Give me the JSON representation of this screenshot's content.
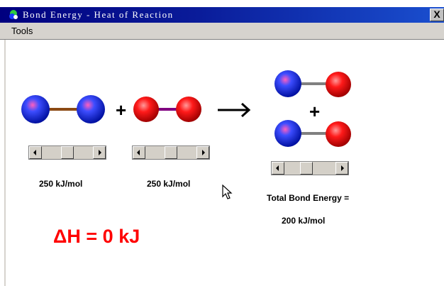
{
  "window": {
    "title": "Bond Energy - Heat of Reaction",
    "close_label": "X"
  },
  "menu": {
    "tools": "Tools"
  },
  "reactants": {
    "plus": "+",
    "bond1_energy": "250 kJ/mol",
    "bond2_energy": "250 kJ/mol",
    "slider1_fraction": 0.5,
    "slider2_fraction": 0.5
  },
  "products": {
    "plus": "+",
    "total_label": "Total Bond Energy =",
    "total_value": "200 kJ/mol",
    "slider_fraction": 0.4
  },
  "result": {
    "delta_h": "ΔH = 0 kJ"
  },
  "colors": {
    "titlebar": "#00007f",
    "blue_atom": "#1a2bff",
    "red_atom": "#ff1a1a",
    "bond_brown": "#8b4a14",
    "bond_purple": "#800080",
    "bond_gray": "#808080",
    "delta_h": "#ff0000"
  }
}
